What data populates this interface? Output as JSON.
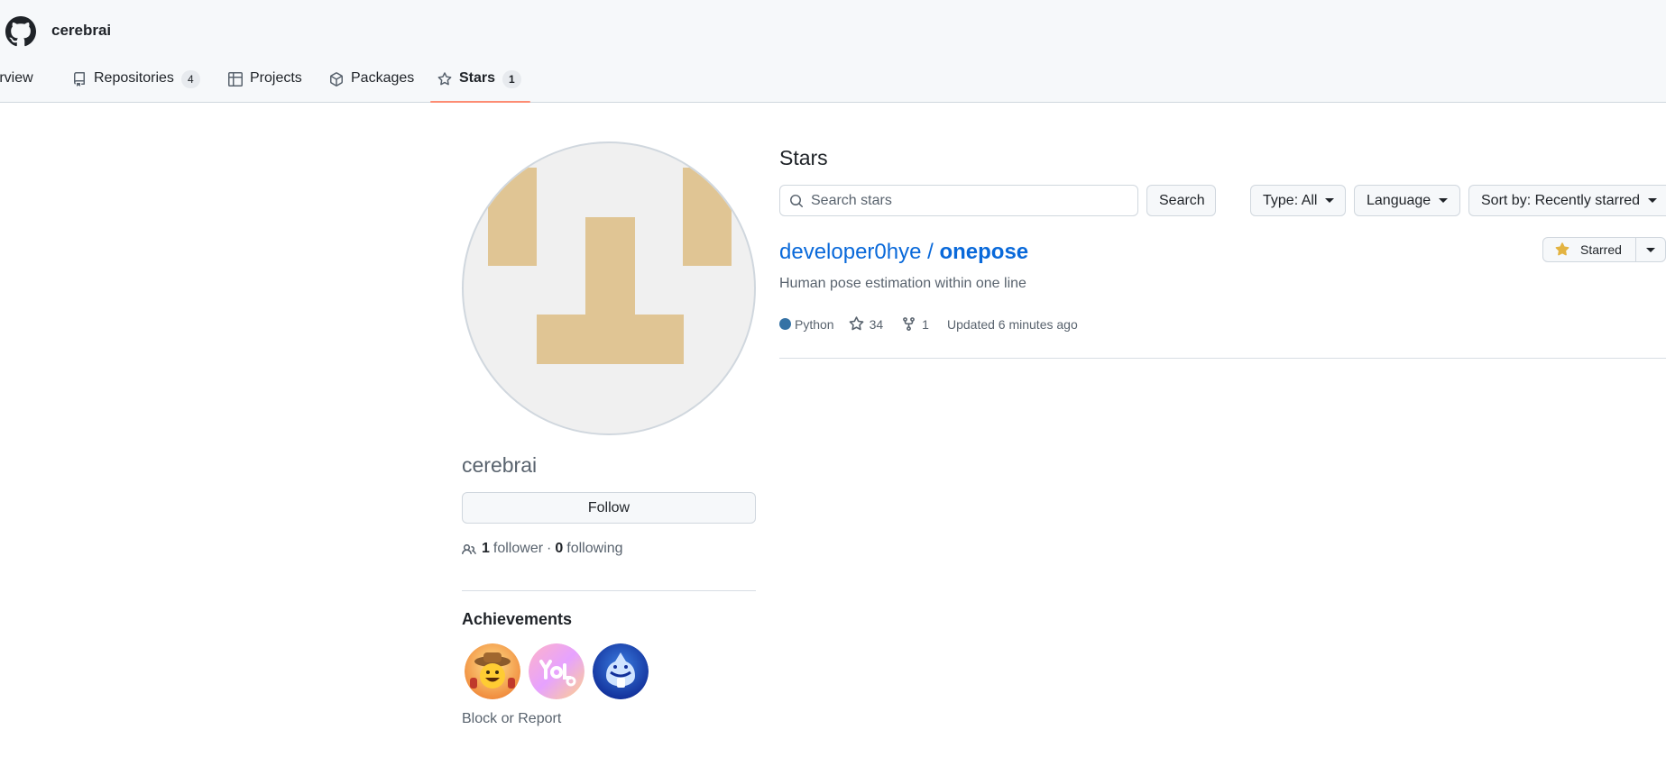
{
  "header": {
    "username": "cerebrai",
    "tabs": [
      {
        "label": "Overview",
        "count": null
      },
      {
        "label": "Repositories",
        "count": "4"
      },
      {
        "label": "Projects",
        "count": null
      },
      {
        "label": "Packages",
        "count": null
      },
      {
        "label": "Stars",
        "count": "1",
        "active": true
      }
    ]
  },
  "profile": {
    "name": "cerebrai",
    "follow_label": "Follow",
    "followers_count": "1",
    "followers_label": "follower",
    "separator": "·",
    "following_count": "0",
    "following_label": "following",
    "achievements_title": "Achievements",
    "block_label": "Block or Report"
  },
  "stars": {
    "title": "Stars",
    "search_placeholder": "Search stars",
    "search_button": "Search",
    "type_filter": "Type: All",
    "language_filter": "Language",
    "sort_filter": "Sort by: Recently starred",
    "repos": [
      {
        "owner": "developer0hye",
        "separator": " / ",
        "name": "onepose",
        "description": "Human pose estimation within one line",
        "language": "Python",
        "language_color": "#3572A5",
        "stars": "34",
        "forks": "1",
        "updated": "Updated 6 minutes ago",
        "starred_label": "Starred"
      }
    ]
  },
  "colors": {
    "accent_link": "#0969da",
    "tab_underline": "#fd8c73",
    "star_fill": "#e3b341",
    "identicon": "#e0c594"
  }
}
